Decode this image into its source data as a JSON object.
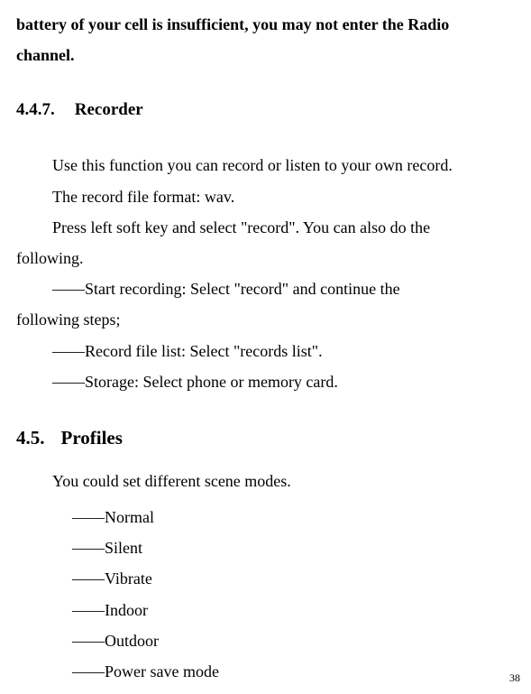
{
  "intro": {
    "line1": "battery of your cell is insufficient, you may not enter the Radio",
    "line2": "channel."
  },
  "section447": {
    "number": "4.4.7.",
    "title": "Recorder",
    "para1": "Use this function you can record or listen to your own record.",
    "para2": "The record file format: wav.",
    "para3_line1": "Press left soft key and select \"record\". You can also do the",
    "para3_line2": "following.",
    "item1_line1": "――Start recording: Select \"record\" and continue the",
    "item1_line2": "following steps;",
    "item2": "――Record file list: Select \"records list\".",
    "item3": "――Storage: Select phone or memory card."
  },
  "section45": {
    "number": "4.5.",
    "title": "Profiles",
    "intro": "You could set different scene modes.",
    "items": [
      "――Normal",
      "――Silent",
      "――Vibrate",
      "――Indoor",
      "――Outdoor",
      "――Power save mode"
    ]
  },
  "pageNumber": "38"
}
